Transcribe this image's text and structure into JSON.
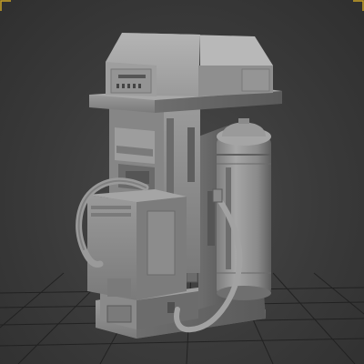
{
  "viewport": {
    "background": "#3a3a3a",
    "grid_color": "#1e1e1e",
    "model_color": "#8f8f8f",
    "selection_corner_color": "#c9a227"
  }
}
